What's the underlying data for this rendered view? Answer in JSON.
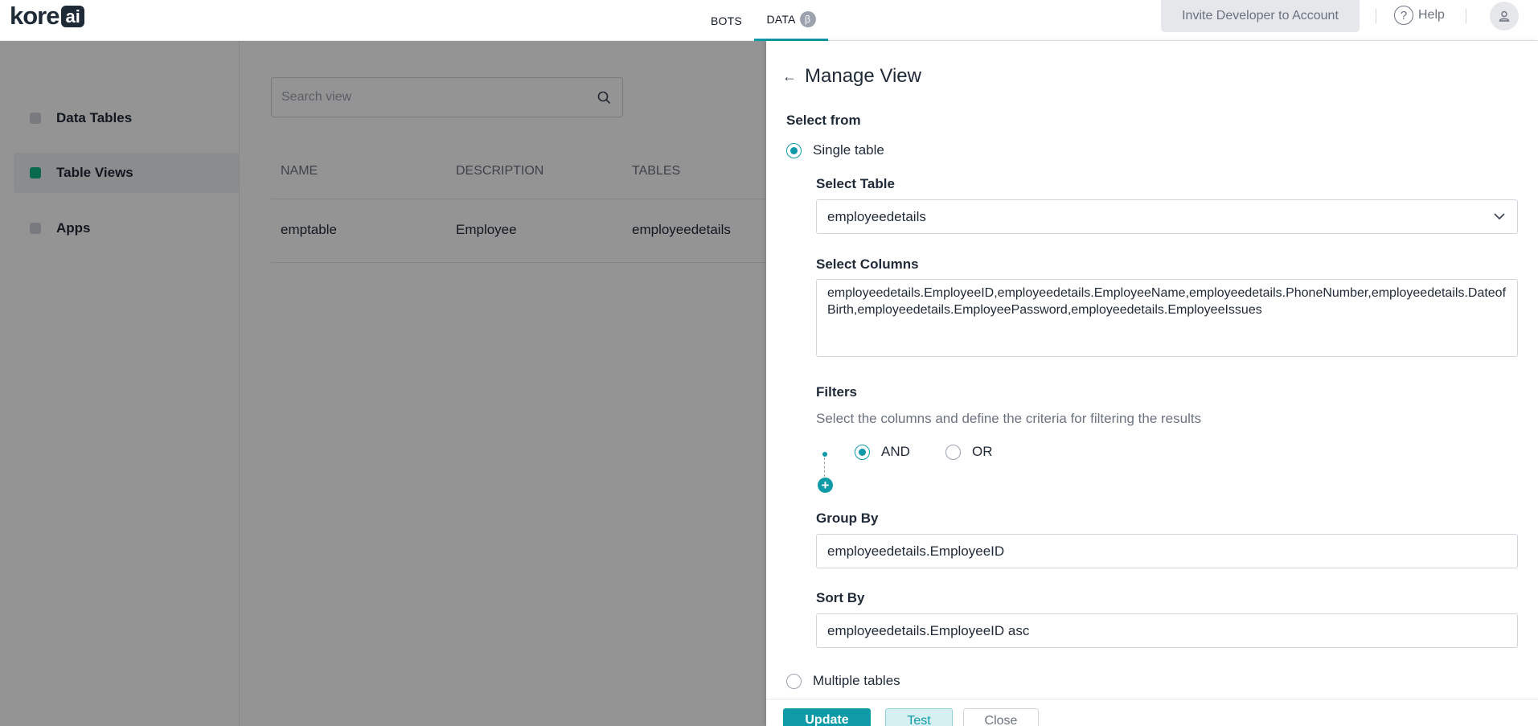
{
  "header": {
    "logo": {
      "text_main": "kore",
      "text_badge": "ai"
    },
    "tabs": [
      {
        "label": "BOTS"
      },
      {
        "label": "DATA",
        "badge": "β"
      }
    ],
    "invite_label": "Invite Developer to Account",
    "help_label": "Help",
    "help_glyph": "?",
    "accent_color": "#0f9aa8"
  },
  "sidebar": {
    "items": [
      {
        "label": "Data Tables",
        "active": false
      },
      {
        "label": "Table Views",
        "active": true
      },
      {
        "label": "Apps",
        "active": false
      }
    ]
  },
  "main": {
    "search_placeholder": "Search view",
    "table": {
      "columns": [
        "NAME",
        "DESCRIPTION",
        "TABLES"
      ],
      "rows": [
        [
          "emptable",
          "Employee",
          "employeedetails"
        ]
      ]
    }
  },
  "panel": {
    "title": "Manage View",
    "select_from_label": "Select from",
    "single_table_label": "Single table",
    "select_table_label": "Select Table",
    "select_table_value": "employeedetails",
    "select_columns_label": "Select Columns",
    "select_columns_value": "employeedetails.EmployeeID,employeedetails.EmployeeName,employeedetails.PhoneNumber,employeedetails.DateofBirth,employeedetails.EmployeePassword,employeedetails.EmployeeIssues",
    "filters_label": "Filters",
    "filters_hint": "Select the columns and define the criteria for filtering the results",
    "and_label": "AND",
    "or_label": "OR",
    "group_by_label": "Group By",
    "group_by_value": "employeedetails.EmployeeID",
    "sort_by_label": "Sort By",
    "sort_by_value": "employeedetails.EmployeeID asc",
    "multiple_tables_label": "Multiple tables",
    "buttons": {
      "update": "Update",
      "test": "Test",
      "close": "Close"
    }
  }
}
